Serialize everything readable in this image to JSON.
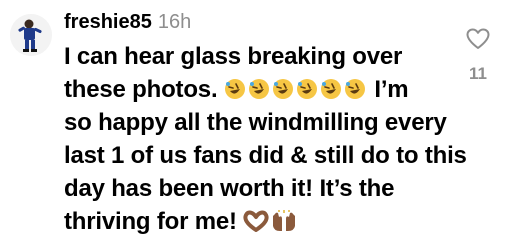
{
  "comment": {
    "username": "freshie85",
    "time": "16h",
    "lines": {
      "l1": "I can hear glass breaking over",
      "l2a": "these photos.",
      "l2b": "I’m",
      "l3": "so happy all the windmilling every",
      "l4": "last 1 of us fans did & still do to this",
      "l5": "day has been worth it! It’s the",
      "l6": "thriving for me!"
    },
    "emojis": {
      "rofl_count": 6,
      "trailing": [
        "heart-hands-icon",
        "raising-hands-icon"
      ]
    },
    "likes": "11"
  },
  "colors": {
    "text": "#000000",
    "secondary": "#8e8e8e",
    "emoji_yellow": "#f6c644",
    "skin_brown": "#8b5a3c"
  }
}
